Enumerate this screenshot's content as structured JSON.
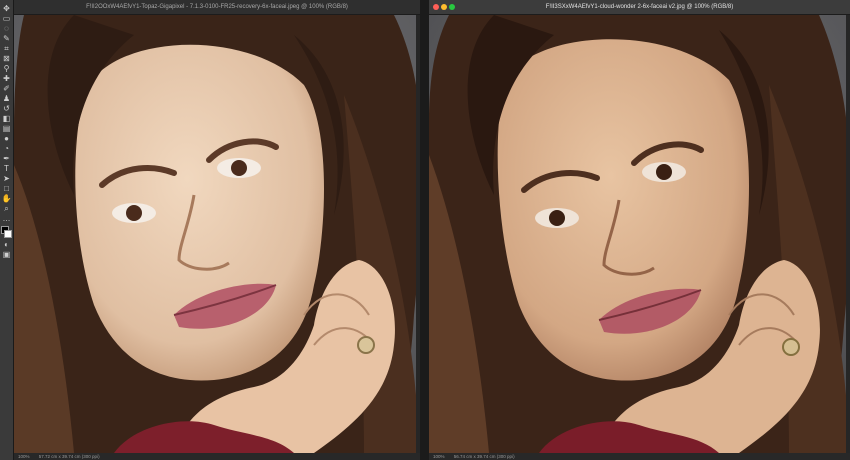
{
  "left_window": {
    "title": "F!II2OOxW4AEfvY1-Topaz-Gigapixel - 7.1.3-0100-FR25-recovery-6x-faceai.jpeg @ 100% (RGB/8)",
    "zoom": "100%",
    "doc_size": "57.72 cm x 39.74 cm (300 ppi)"
  },
  "right_window": {
    "title": "F!II3SXxW4AEfvY1-cloud-wonder 2-6x-faceai v2.jpg @ 100% (RGB/8)",
    "zoom": "100%",
    "doc_size": "56.74 cm x 39.74 cm (300 ppi)"
  },
  "toolbar": {
    "tools": [
      {
        "icon": "move-icon",
        "glyph": "✥"
      },
      {
        "icon": "artboard-icon",
        "glyph": "▭"
      },
      {
        "icon": "lasso-icon",
        "glyph": "◌"
      },
      {
        "icon": "quick-select-icon",
        "glyph": "✎"
      },
      {
        "icon": "crop-icon",
        "glyph": "⌗"
      },
      {
        "icon": "frame-icon",
        "glyph": "⊠"
      },
      {
        "icon": "eyedropper-icon",
        "glyph": "⚲"
      },
      {
        "icon": "healing-icon",
        "glyph": "✚"
      },
      {
        "icon": "brush-icon",
        "glyph": "✐"
      },
      {
        "icon": "clone-stamp-icon",
        "glyph": "♟"
      },
      {
        "icon": "history-brush-icon",
        "glyph": "↺"
      },
      {
        "icon": "eraser-icon",
        "glyph": "◧"
      },
      {
        "icon": "gradient-icon",
        "glyph": "▤"
      },
      {
        "icon": "blur-icon",
        "glyph": "●"
      },
      {
        "icon": "dodge-icon",
        "glyph": "◔"
      },
      {
        "icon": "pen-icon",
        "glyph": "✒"
      },
      {
        "icon": "type-icon",
        "glyph": "T"
      },
      {
        "icon": "path-select-icon",
        "glyph": "➤"
      },
      {
        "icon": "rectangle-icon",
        "glyph": "□"
      },
      {
        "icon": "hand-icon",
        "glyph": "✋"
      },
      {
        "icon": "zoom-icon",
        "glyph": "⌕"
      },
      {
        "icon": "more-tools-icon",
        "glyph": "…"
      }
    ],
    "foreground_color": "#000000",
    "background_color": "#ffffff",
    "extra_icons": [
      {
        "icon": "quick-mask-icon",
        "glyph": "◐"
      },
      {
        "icon": "screen-mode-icon",
        "glyph": "▣"
      }
    ]
  },
  "colors": {
    "backdrop": "#6f6f72",
    "hair_dark": "#2e1c13",
    "hair_mid": "#5a3a26",
    "skin_left": "#e7c9ad",
    "skin_right": "#dcb28f",
    "lips": "#b8606d",
    "sweater": "#7d1f2b"
  }
}
